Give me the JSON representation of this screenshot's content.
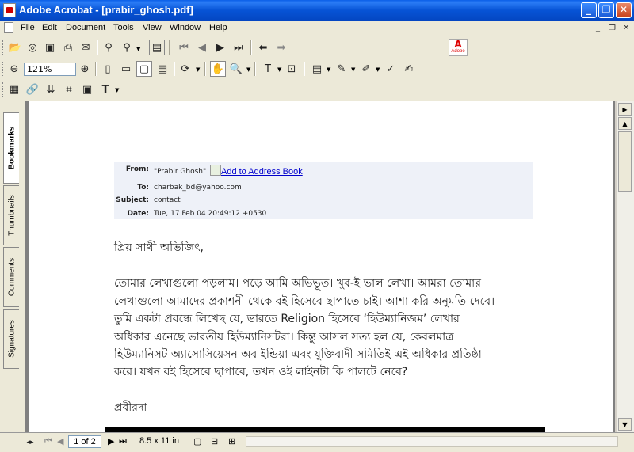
{
  "window": {
    "title": "Adobe Acrobat - [prabir_ghosh.pdf]"
  },
  "menu": [
    "File",
    "Edit",
    "Document",
    "Tools",
    "View",
    "Window",
    "Help"
  ],
  "toolbar": {
    "zoom": "121%",
    "adobe_logo": "Adobe"
  },
  "side_tabs": [
    "Bookmarks",
    "Thumbnails",
    "Comments",
    "Signatures"
  ],
  "email": {
    "from_label": "From:",
    "from_value": "\"Prabir Ghosh\"",
    "add_link": "Add to Address Book",
    "to_label": "To:",
    "to_value": "charbak_bd@yahoo.com",
    "subject_label": "Subject:",
    "subject_value": "contact",
    "date_label": "Date:",
    "date_value": "Tue, 17 Feb 04 20:49:12 +0530"
  },
  "letter": {
    "salutation": "প্রিয় সাথী অভিজিৎ,",
    "lines": [
      "তোমার লেখাগুলো পড়লাম। পড়ে আমি অভিভূত। খুব-ই ভাল লেখা। আমরা তোমার",
      "লেখাগুলো আমাদের প্রকাশনী থেকে বই হিসেবে ছাপাতে চাই। আশা করি অনুমতি দেবে।",
      "তুমি একটা প্রবন্ধে লিখেছ যে, ভারতে Religion হিসেবে ‘হিউম্যানিজম’ লেখার",
      "অধিকার এনেছে ভারতীয় হিউম্যানিসটরা। কিন্তু আসল সত্য হল যে,  কেবলমাত্র",
      "হিউম্যানিসট অ্যাসোসিয়েসন অব ইন্ডিয়া এবং যুক্তিবাদী সমিতিই এই অধিকার প্রতিষ্ঠা",
      "করে।  যখন বই হিসেবে ছাপাবে, তখন ওই লাইনটা কি পালটে নেবে?"
    ],
    "signoff": "প্রবীরদা"
  },
  "status": {
    "page": "1 of 2",
    "page_size": "8.5 x 11 in"
  }
}
